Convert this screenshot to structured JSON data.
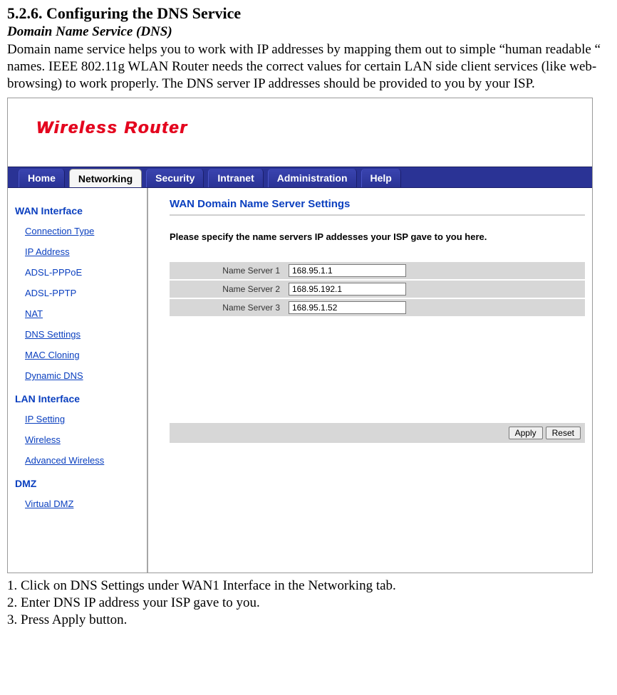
{
  "doc": {
    "section_heading": "5.2.6. Configuring the DNS Service",
    "sub_heading": "Domain Name Service (DNS)",
    "paragraph": "Domain name service helps you to work with IP addresses by mapping them out to simple “human readable “ names. IEEE 802.11g WLAN Router needs the correct values for certain LAN side client services (like web-browsing) to work properly. The DNS server IP addresses should be provided to you by your ISP.",
    "steps": [
      "1. Click on DNS Settings under WAN1 Interface in the Networking tab.",
      "2. Enter DNS IP address your ISP gave to you.",
      "3. Press Apply button."
    ]
  },
  "router": {
    "brand": "Wireless Router",
    "nav": {
      "home": "Home",
      "networking": "Networking",
      "security": "Security",
      "intranet": "Intranet",
      "administration": "Administration",
      "help": "Help"
    },
    "sidebar": {
      "wan_heading": "WAN Interface",
      "wan_items": {
        "connection_type": "Connection Type",
        "ip_address": "IP Address",
        "adsl_pppoe": "ADSL-PPPoE",
        "adsl_pptp": "ADSL-PPTP",
        "nat": "NAT",
        "dns_settings": "DNS Settings",
        "mac_cloning": "MAC Cloning",
        "dynamic_dns": "Dynamic DNS"
      },
      "lan_heading": "LAN Interface",
      "lan_items": {
        "ip_setting": "IP Setting",
        "wireless": "Wireless",
        "advanced_wireless": "Advanced Wireless"
      },
      "dmz_heading": "DMZ",
      "dmz_items": {
        "virtual_dmz": "Virtual DMZ"
      }
    },
    "panel": {
      "title": "WAN Domain Name Server Settings",
      "instruction": "Please specify the name servers IP addesses your ISP gave to you here.",
      "fields": {
        "ns1_label": "Name Server 1",
        "ns1_value": "168.95.1.1",
        "ns2_label": "Name Server 2",
        "ns2_value": "168.95.192.1",
        "ns3_label": "Name Server 3",
        "ns3_value": "168.95.1.52"
      },
      "buttons": {
        "apply": "Apply",
        "reset": "Reset"
      }
    }
  }
}
